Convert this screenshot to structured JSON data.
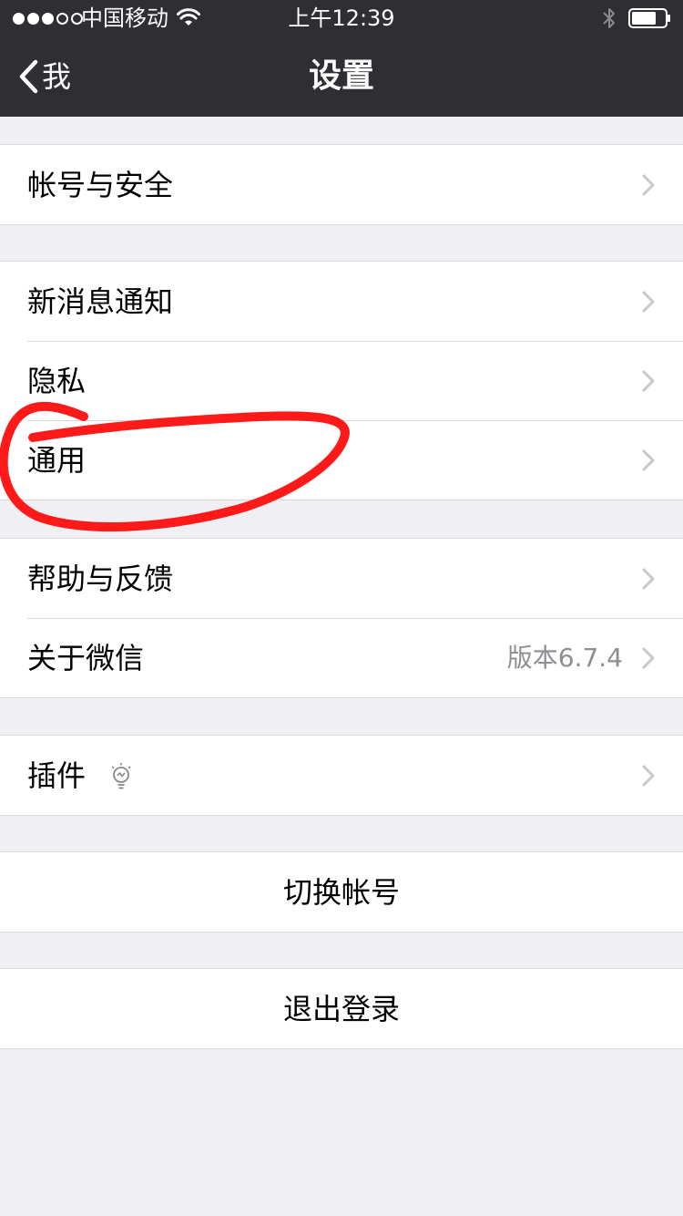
{
  "status_bar": {
    "signal_dots": [
      true,
      true,
      true,
      false,
      false
    ],
    "carrier": "中国移动",
    "wifi_icon": "wifi-icon",
    "time": "上午12:39",
    "bluetooth_icon": "bluetooth-icon",
    "battery_icon": "battery-icon"
  },
  "nav": {
    "back_label": "我",
    "back_icon": "chevron-left-icon",
    "title": "设置"
  },
  "groups": [
    {
      "items": [
        {
          "label": "帐号与安全"
        }
      ]
    },
    {
      "items": [
        {
          "label": "新消息通知"
        },
        {
          "label": "隐私"
        },
        {
          "label": "通用"
        }
      ]
    },
    {
      "items": [
        {
          "label": "帮助与反馈"
        },
        {
          "label": "关于微信",
          "value": "版本6.7.4"
        }
      ]
    },
    {
      "items": [
        {
          "label": "插件",
          "icon": "lightbulb-icon"
        }
      ]
    }
  ],
  "actions": {
    "switch_account": "切换帐号",
    "logout": "退出登录"
  },
  "colors": {
    "nav_background": "#2f2f33",
    "page_background": "#efeff4",
    "cell_background": "#ffffff",
    "secondary_text": "#8e8e93",
    "annotation_stroke": "#ff1a1a"
  }
}
